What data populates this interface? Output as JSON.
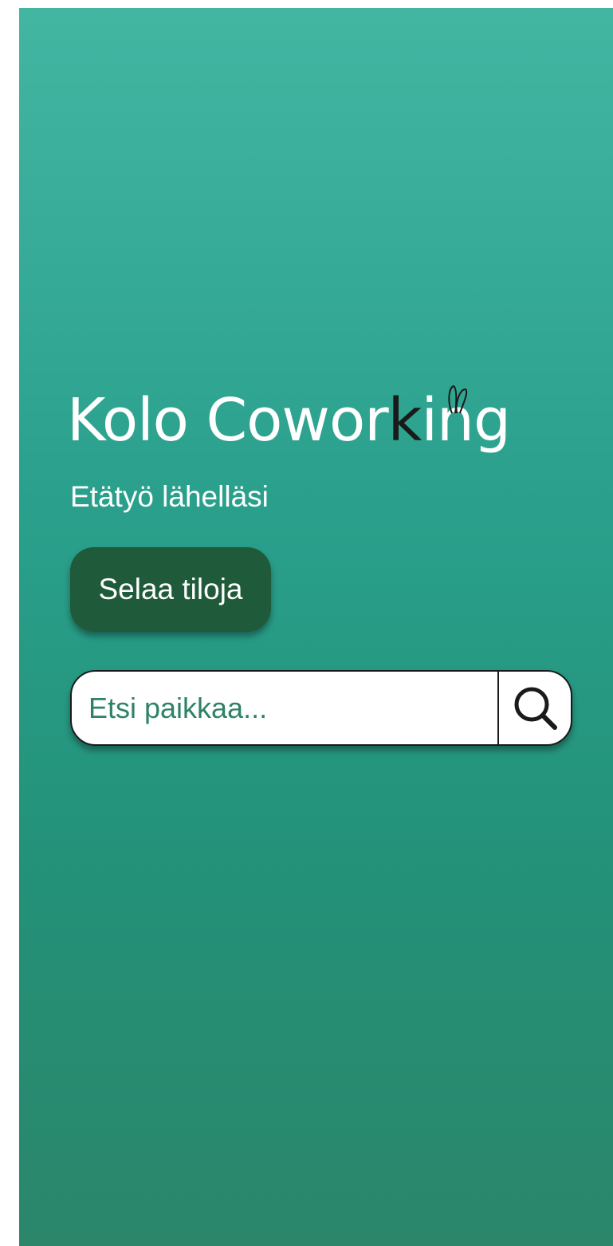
{
  "brand": {
    "title_before": "Kolo Cowor",
    "title_highlight": "k",
    "title_after": "ing",
    "tagline": "Etätyö lähelläsi"
  },
  "actions": {
    "browse_label": "Selaa tiloja"
  },
  "search": {
    "placeholder": "Etsi paikkaa...",
    "icon": "search-icon"
  },
  "colors": {
    "gradient_top": "#43b6a2",
    "gradient_bottom": "#2b866a",
    "button_bg": "#1f5a3a",
    "placeholder_text": "#2e8366"
  }
}
